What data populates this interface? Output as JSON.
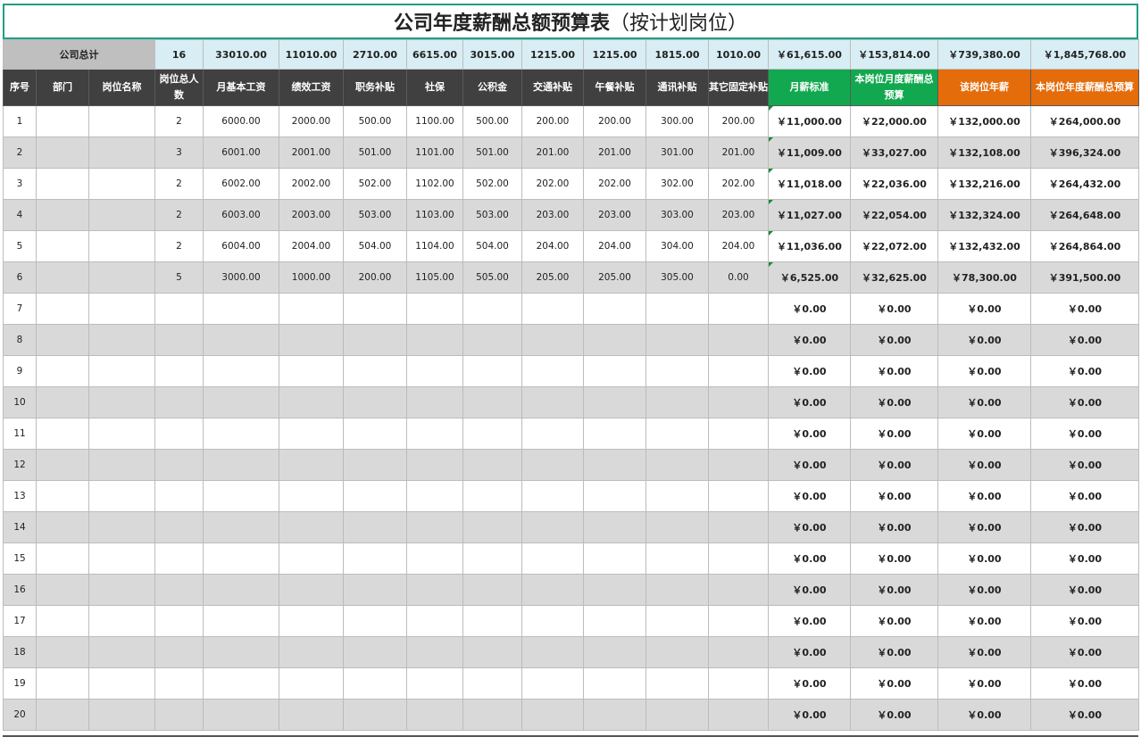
{
  "title": {
    "main": "公司年度薪酬总额预算表",
    "sub": "（按计划岗位）"
  },
  "totals": {
    "label": "公司总计",
    "values": [
      "16",
      "33010.00",
      "11010.00",
      "2710.00",
      "6615.00",
      "3015.00",
      "1215.00",
      "1215.00",
      "1815.00",
      "1010.00",
      "￥61,615.00",
      "￥153,814.00",
      "￥739,380.00",
      "￥1,845,768.00"
    ]
  },
  "headers": [
    "序号",
    "部门",
    "岗位名称",
    "岗位总人数",
    "月基本工资",
    "绩效工资",
    "职务补贴",
    "社保",
    "公积金",
    "交通补贴",
    "午餐补贴",
    "通讯补贴",
    "其它固定补贴",
    "月薪标准",
    "本岗位月度薪酬总预算",
    "该岗位年薪",
    "本岗位年度薪酬总预算"
  ],
  "colors": {
    "header_dark": "#404040",
    "header_green": "#12a84f",
    "header_orange": "#e46c0a",
    "total_row": "#d8eef4",
    "title_border": "#1f9e86"
  },
  "rows": [
    [
      "1",
      "",
      "",
      "2",
      "6000.00",
      "2000.00",
      "500.00",
      "1100.00",
      "500.00",
      "200.00",
      "200.00",
      "300.00",
      "200.00",
      "￥11,000.00",
      "￥22,000.00",
      "￥132,000.00",
      "￥264,000.00"
    ],
    [
      "2",
      "",
      "",
      "3",
      "6001.00",
      "2001.00",
      "501.00",
      "1101.00",
      "501.00",
      "201.00",
      "201.00",
      "301.00",
      "201.00",
      "￥11,009.00",
      "￥33,027.00",
      "￥132,108.00",
      "￥396,324.00"
    ],
    [
      "3",
      "",
      "",
      "2",
      "6002.00",
      "2002.00",
      "502.00",
      "1102.00",
      "502.00",
      "202.00",
      "202.00",
      "302.00",
      "202.00",
      "￥11,018.00",
      "￥22,036.00",
      "￥132,216.00",
      "￥264,432.00"
    ],
    [
      "4",
      "",
      "",
      "2",
      "6003.00",
      "2003.00",
      "503.00",
      "1103.00",
      "503.00",
      "203.00",
      "203.00",
      "303.00",
      "203.00",
      "￥11,027.00",
      "￥22,054.00",
      "￥132,324.00",
      "￥264,648.00"
    ],
    [
      "5",
      "",
      "",
      "2",
      "6004.00",
      "2004.00",
      "504.00",
      "1104.00",
      "504.00",
      "204.00",
      "204.00",
      "304.00",
      "204.00",
      "￥11,036.00",
      "￥22,072.00",
      "￥132,432.00",
      "￥264,864.00"
    ],
    [
      "6",
      "",
      "",
      "5",
      "3000.00",
      "1000.00",
      "200.00",
      "1105.00",
      "505.00",
      "205.00",
      "205.00",
      "305.00",
      "0.00",
      "￥6,525.00",
      "￥32,625.00",
      "￥78,300.00",
      "￥391,500.00"
    ],
    [
      "7",
      "",
      "",
      "",
      "",
      "",
      "",
      "",
      "",
      "",
      "",
      "",
      "",
      "￥0.00",
      "￥0.00",
      "￥0.00",
      "￥0.00"
    ],
    [
      "8",
      "",
      "",
      "",
      "",
      "",
      "",
      "",
      "",
      "",
      "",
      "",
      "",
      "￥0.00",
      "￥0.00",
      "￥0.00",
      "￥0.00"
    ],
    [
      "9",
      "",
      "",
      "",
      "",
      "",
      "",
      "",
      "",
      "",
      "",
      "",
      "",
      "￥0.00",
      "￥0.00",
      "￥0.00",
      "￥0.00"
    ],
    [
      "10",
      "",
      "",
      "",
      "",
      "",
      "",
      "",
      "",
      "",
      "",
      "",
      "",
      "￥0.00",
      "￥0.00",
      "￥0.00",
      "￥0.00"
    ],
    [
      "11",
      "",
      "",
      "",
      "",
      "",
      "",
      "",
      "",
      "",
      "",
      "",
      "",
      "￥0.00",
      "￥0.00",
      "￥0.00",
      "￥0.00"
    ],
    [
      "12",
      "",
      "",
      "",
      "",
      "",
      "",
      "",
      "",
      "",
      "",
      "",
      "",
      "￥0.00",
      "￥0.00",
      "￥0.00",
      "￥0.00"
    ],
    [
      "13",
      "",
      "",
      "",
      "",
      "",
      "",
      "",
      "",
      "",
      "",
      "",
      "",
      "￥0.00",
      "￥0.00",
      "￥0.00",
      "￥0.00"
    ],
    [
      "14",
      "",
      "",
      "",
      "",
      "",
      "",
      "",
      "",
      "",
      "",
      "",
      "",
      "￥0.00",
      "￥0.00",
      "￥0.00",
      "￥0.00"
    ],
    [
      "15",
      "",
      "",
      "",
      "",
      "",
      "",
      "",
      "",
      "",
      "",
      "",
      "",
      "￥0.00",
      "￥0.00",
      "￥0.00",
      "￥0.00"
    ],
    [
      "16",
      "",
      "",
      "",
      "",
      "",
      "",
      "",
      "",
      "",
      "",
      "",
      "",
      "￥0.00",
      "￥0.00",
      "￥0.00",
      "￥0.00"
    ],
    [
      "17",
      "",
      "",
      "",
      "",
      "",
      "",
      "",
      "",
      "",
      "",
      "",
      "",
      "￥0.00",
      "￥0.00",
      "￥0.00",
      "￥0.00"
    ],
    [
      "18",
      "",
      "",
      "",
      "",
      "",
      "",
      "",
      "",
      "",
      "",
      "",
      "",
      "￥0.00",
      "￥0.00",
      "￥0.00",
      "￥0.00"
    ],
    [
      "19",
      "",
      "",
      "",
      "",
      "",
      "",
      "",
      "",
      "",
      "",
      "",
      "",
      "￥0.00",
      "￥0.00",
      "￥0.00",
      "￥0.00"
    ],
    [
      "20",
      "",
      "",
      "",
      "",
      "",
      "",
      "",
      "",
      "",
      "",
      "",
      "",
      "￥0.00",
      "￥0.00",
      "￥0.00",
      "￥0.00"
    ]
  ]
}
